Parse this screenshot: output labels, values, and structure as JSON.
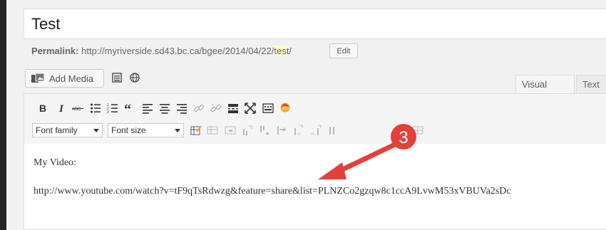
{
  "post": {
    "title": "Test",
    "permalink_label": "Permalink:",
    "permalink_url": "http://myriverside.sd43.bc.ca/bgee/2014/04/22/",
    "permalink_slug": "test",
    "permalink_end": "/",
    "edit_label": "Edit"
  },
  "media": {
    "add_media_label": "Add Media"
  },
  "tabs": {
    "visual": "Visual",
    "text": "Text"
  },
  "toolbar": {
    "font_family": "Font family",
    "font_size": "Font size",
    "row1_icons": [
      "bold-icon",
      "italic-icon",
      "strikethrough-icon",
      "bullet-list-icon",
      "numbered-list-icon",
      "blockquote-icon",
      "align-left-icon",
      "align-center-icon",
      "align-right-icon",
      "link-icon",
      "unlink-icon",
      "read-more-icon",
      "fullscreen-icon",
      "toolbar-toggle-icon",
      "wordpress-icon"
    ],
    "row2_icons": [
      "insert-table-icon",
      "table-props-icon",
      "cell-props-icon",
      "insert-row-before-icon",
      "insert-row-after-icon",
      "delete-row-icon",
      "col-before-icon",
      "col-after-icon",
      "delete-col-icon",
      "merge-cells-icon"
    ]
  },
  "content": {
    "line1": "My Video:",
    "line2": "http://www.youtube.com/watch?v=tF9qTsRdwzg&feature=share&list=PLNZCo2gzqw8c1ccA9LvwM53xVBUVa2sDc"
  },
  "annotation": {
    "step_number": "3",
    "color": "#e3403a"
  }
}
